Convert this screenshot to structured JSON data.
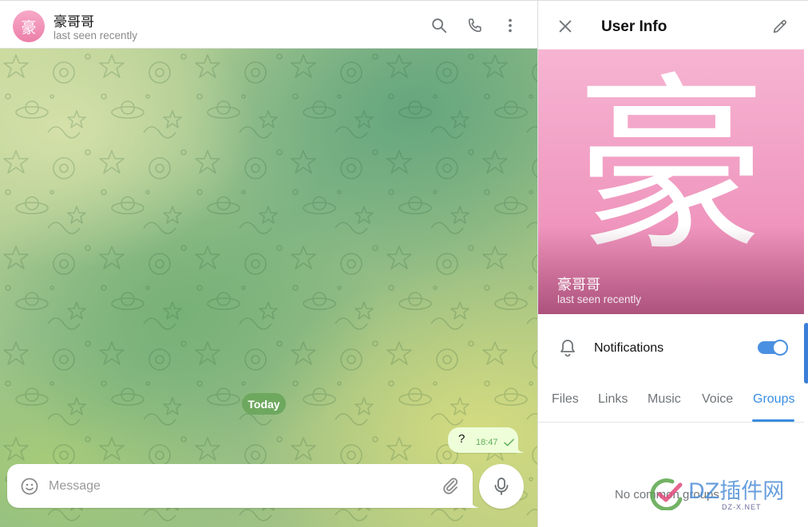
{
  "chat": {
    "avatar_letter": "豪",
    "title": "豪哥哥",
    "status": "last seen recently",
    "date_label": "Today",
    "messages": [
      {
        "text": "?",
        "time": "18:47",
        "status": "sent"
      }
    ],
    "composer": {
      "placeholder": "Message"
    }
  },
  "panel": {
    "title": "User Info",
    "cover_letter": "豪",
    "name": "豪哥哥",
    "status": "last seen recently",
    "notifications": {
      "label": "Notifications",
      "enabled": true
    },
    "tabs": [
      "Files",
      "Links",
      "Music",
      "Voice",
      "Groups"
    ],
    "active_tab": "Groups",
    "empty_message": "No common groups"
  },
  "watermark": {
    "brand": "DZ插件网",
    "domain": "DZ-X.NET"
  },
  "colors": {
    "accent": "#3a8de0",
    "avatar_pink": "#ec7fa9",
    "bubble_out": "#eefed9",
    "date_pill": "#6ea85f"
  },
  "icons": [
    "search-icon",
    "phone-icon",
    "more-vertical-icon",
    "emoji-icon",
    "paperclip-icon",
    "microphone-icon",
    "close-icon",
    "pencil-icon",
    "bell-icon",
    "check-icon"
  ]
}
